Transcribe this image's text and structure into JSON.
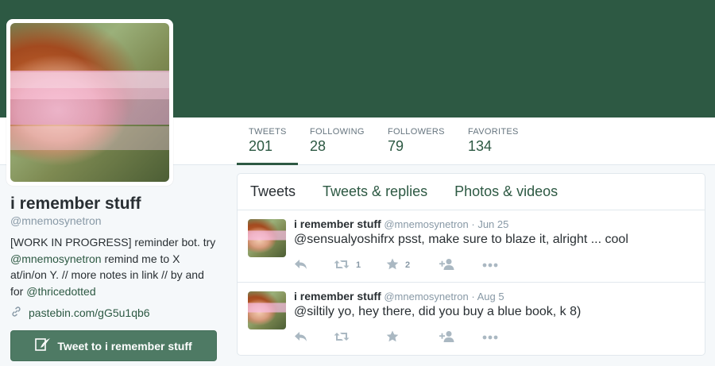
{
  "colors": {
    "header_bg": "#2d5943",
    "accent": "#2d5943",
    "tweet_button_bg": "#4e7a64",
    "muted_text": "#8899a6"
  },
  "profile": {
    "name": "i remember stuff",
    "handle": "@mnemosynetron",
    "bio": {
      "part1": "[WORK IN PROGRESS] reminder bot. try ",
      "mention1": "@mnemosynetron",
      "part2": " remind me to X at/in/on Y. // more notes in link // by and for ",
      "mention2": "@thricedotted"
    },
    "link": "pastebin.com/gG5u1qb6",
    "link_icon": "link-icon",
    "tweet_to_label": "Tweet to i remember stuff",
    "tweet_to_icon": "quill-icon"
  },
  "stats": [
    {
      "label": "TWEETS",
      "value": "201",
      "active": true
    },
    {
      "label": "FOLLOWING",
      "value": "28",
      "active": false
    },
    {
      "label": "FOLLOWERS",
      "value": "79",
      "active": false
    },
    {
      "label": "FAVORITES",
      "value": "134",
      "active": false
    }
  ],
  "timeline": {
    "tabs": [
      "Tweets",
      "Tweets & replies",
      "Photos & videos"
    ],
    "tweets": [
      {
        "name": "i remember stuff",
        "handle": "@mnemosynetron",
        "sep": "·",
        "date": "Jun 25",
        "text": "@sensualyoshifrx psst, make sure to blaze it, alright ... cool",
        "retweets": "1",
        "favorites": "2"
      },
      {
        "name": "i remember stuff",
        "handle": "@mnemosynetron",
        "sep": "·",
        "date": "Aug 5",
        "text": "@siltily yo, hey there, did you buy a blue book, k 8)",
        "retweets": "",
        "favorites": ""
      }
    ]
  }
}
